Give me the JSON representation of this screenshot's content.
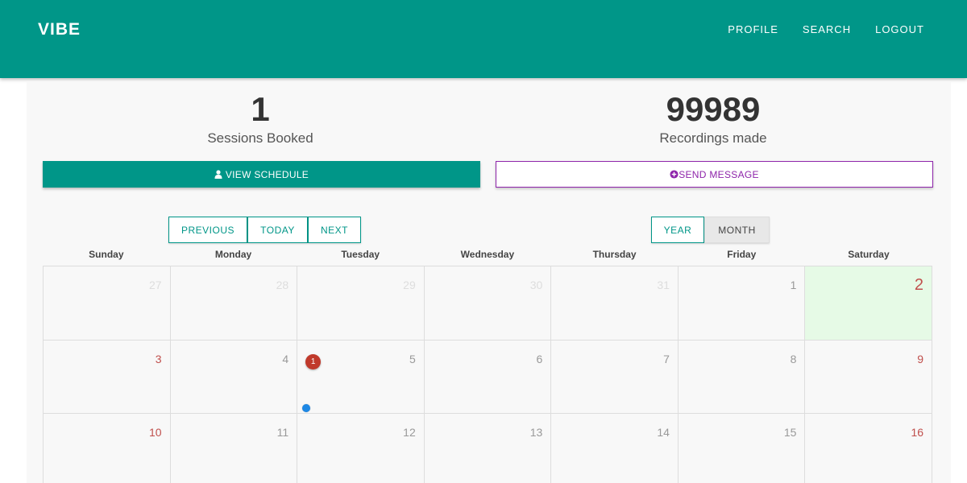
{
  "nav": {
    "brand": "VIBE",
    "links": [
      "PROFILE",
      "SEARCH",
      "LOGOUT"
    ]
  },
  "stats": {
    "sessions": {
      "value": "1",
      "label": "Sessions Booked"
    },
    "recordings": {
      "value": "99989",
      "label": "Recordings made"
    }
  },
  "actions": {
    "view_schedule": "VIEW SCHEDULE",
    "send_message": "SEND MESSAGE"
  },
  "calendar_nav": {
    "previous": "PREVIOUS",
    "today": "TODAY",
    "next": "NEXT",
    "year": "YEAR",
    "month": "MONTH",
    "active_view": "MONTH"
  },
  "weekdays": [
    "Sunday",
    "Monday",
    "Tuesday",
    "Wednesday",
    "Thursday",
    "Friday",
    "Saturday"
  ],
  "weeks": [
    [
      {
        "n": "27",
        "muted": true
      },
      {
        "n": "28",
        "muted": true
      },
      {
        "n": "29",
        "muted": true
      },
      {
        "n": "30",
        "muted": true
      },
      {
        "n": "31",
        "muted": true
      },
      {
        "n": "1"
      },
      {
        "n": "2",
        "today": true
      }
    ],
    [
      {
        "n": "3",
        "weekend": true
      },
      {
        "n": "4"
      },
      {
        "n": "5",
        "badge": "1",
        "event": true
      },
      {
        "n": "6"
      },
      {
        "n": "7"
      },
      {
        "n": "8"
      },
      {
        "n": "9",
        "weekend": true
      }
    ],
    [
      {
        "n": "10",
        "weekend": true
      },
      {
        "n": "11"
      },
      {
        "n": "12"
      },
      {
        "n": "13"
      },
      {
        "n": "14"
      },
      {
        "n": "15"
      },
      {
        "n": "16",
        "weekend": true
      }
    ]
  ],
  "colors": {
    "primary": "#009688",
    "accent": "#8e24aa",
    "today_bg": "#e6fae6",
    "weekend_text": "#c0504d",
    "badge": "#c0392b",
    "event_dot": "#1e88e5"
  }
}
